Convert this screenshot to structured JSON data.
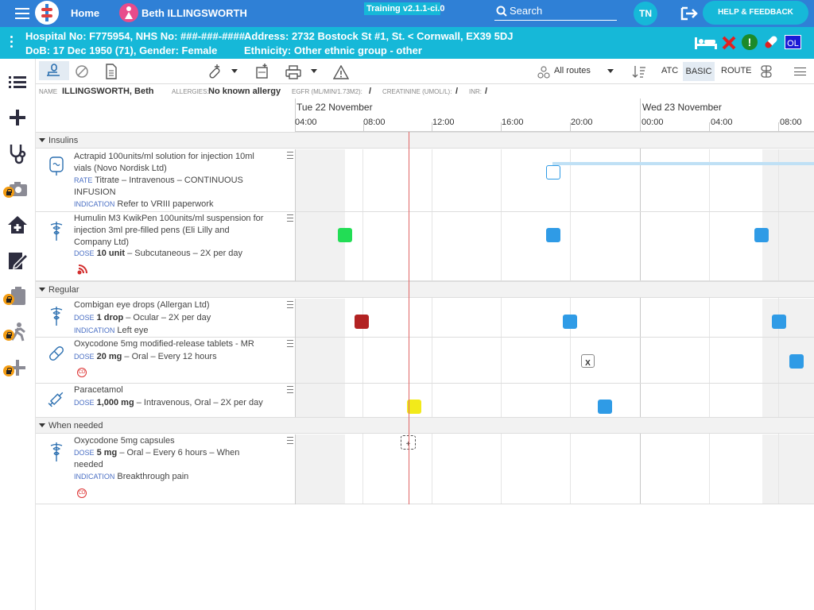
{
  "topbar": {
    "home": "Home",
    "patient_name": "Beth ILLINGSWORTH",
    "version": "Training v2.1.1-ci.0",
    "search_placeholder": "Search",
    "user_initials": "TN",
    "help_label": "HELP & FEEDBACK"
  },
  "patient": {
    "hospital_line": "Hospital No: F775954, NHS No: ###-###-####",
    "address": "Address: 2732 Bostock St #1, St. < Cornwall, EX39 5DJ",
    "dob_line": "DoB: 17 Dec 1950 (71), Gender: Female",
    "ethnicity": "Ethnicity: Other ethnic group - other",
    "ol_badge": "OL"
  },
  "toolbar": {
    "routes": "All routes",
    "atc": "ATC",
    "basic": "BASIC",
    "route": "ROUTE"
  },
  "info": {
    "name_label": "NAME",
    "name": "ILLINGSWORTH, Beth",
    "allergies_label": "ALLERGIES:",
    "allergies": "No known allergy",
    "egfr_label": "EGFR (ML/MIN/1.73M2):",
    "egfr": "/",
    "creat_label": "CREATININE (UMOL/L):",
    "creat": "/",
    "inr_label": "INR:",
    "inr": "/"
  },
  "timeline": {
    "day1": "Tue 22 November",
    "day2": "Wed 23 November",
    "ticks": [
      "04:00",
      "08:00",
      "12:00",
      "16:00",
      "20:00",
      "00:00",
      "04:00",
      "08:00"
    ]
  },
  "sections": {
    "insulins": "Insulins",
    "regular": "Regular",
    "when_needed": "When needed"
  },
  "meds": {
    "actrapid": {
      "name": "Actrapid 100units/ml solution for injection 10ml vials (Novo Nordisk Ltd)",
      "k1": "RATE",
      "v1": "Titrate – Intravenous – CONTINUOUS INFUSION",
      "k2": "INDICATION",
      "v2": "Refer to VRIII paperwork"
    },
    "humulin": {
      "name": "Humulin M3 KwikPen 100units/ml suspension for injection 3ml pre-filled pens (Eli Lilly and Company Ltd)",
      "k1": "DOSE",
      "dose": "10 unit",
      "v1": " – Subcutaneous – 2X per day"
    },
    "combigan": {
      "name": "Combigan eye drops (Allergan Ltd)",
      "k1": "DOSE",
      "dose": "1 drop",
      "v1": " – Ocular – 2X per day",
      "k2": "INDICATION",
      "v2": "Left eye"
    },
    "oxy_mr": {
      "name": "Oxycodone 5mg modified-release tablets - MR",
      "k1": "DOSE",
      "dose": "20 mg",
      "v1": " – Oral – Every 12 hours",
      "cd": "CD"
    },
    "paracetamol": {
      "name": "Paracetamol",
      "k1": "DOSE",
      "dose": "1,000 mg",
      "v1": " – Intravenous, Oral – 2X per day"
    },
    "oxy_caps": {
      "name": "Oxycodone 5mg capsules",
      "k1": "DOSE",
      "dose": "5 mg",
      "v1": " – Oral – Every 6 hours – When needed",
      "k2": "INDICATION",
      "v2": "Breakthrough pain",
      "cd": "CD"
    }
  },
  "markers": {
    "missed": "X",
    "add": "+"
  },
  "colors": {
    "topbar": "#2f80d6",
    "patientbar": "#16b8d8",
    "given": "#22dd55",
    "due": "#2f9be6",
    "refused": "#b22222",
    "late": "#f2ea1a",
    "now_line": "#e06666"
  }
}
